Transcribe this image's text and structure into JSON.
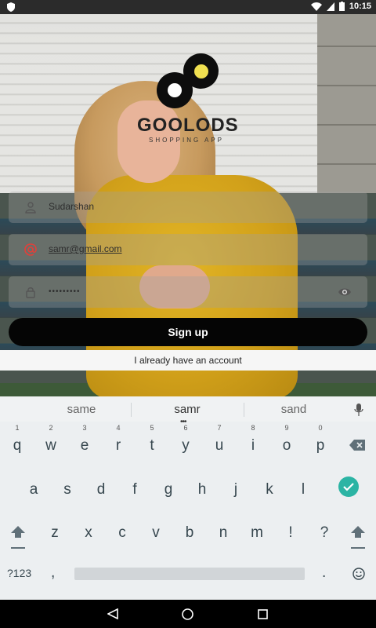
{
  "status_bar": {
    "time": "10:15"
  },
  "app": {
    "brand": "GOOLODS",
    "tagline": "SHOPPING APP"
  },
  "form": {
    "name_value": "Sudarshan",
    "email_value": "samr@gmail.com",
    "password_value": "•••••••••",
    "signup_label": "Sign up",
    "have_account_label": "I already have an account"
  },
  "keyboard": {
    "suggestions": [
      "same",
      "samr",
      "sand"
    ],
    "row1": [
      {
        "hint": "1",
        "key": "q"
      },
      {
        "hint": "2",
        "key": "w"
      },
      {
        "hint": "3",
        "key": "e"
      },
      {
        "hint": "4",
        "key": "r"
      },
      {
        "hint": "5",
        "key": "t"
      },
      {
        "hint": "6",
        "key": "y"
      },
      {
        "hint": "7",
        "key": "u"
      },
      {
        "hint": "8",
        "key": "i"
      },
      {
        "hint": "9",
        "key": "o"
      },
      {
        "hint": "0",
        "key": "p"
      }
    ],
    "row2": [
      "a",
      "s",
      "d",
      "f",
      "g",
      "h",
      "j",
      "k",
      "l"
    ],
    "row3": [
      "z",
      "x",
      "c",
      "v",
      "b",
      "n",
      "m",
      "!",
      "?"
    ],
    "sym_label": "?123",
    "comma": ",",
    "period": "."
  },
  "colors": {
    "accent_teal": "#2bb4a4",
    "email_icon_red": "#e0403a",
    "button_black": "#050505"
  }
}
